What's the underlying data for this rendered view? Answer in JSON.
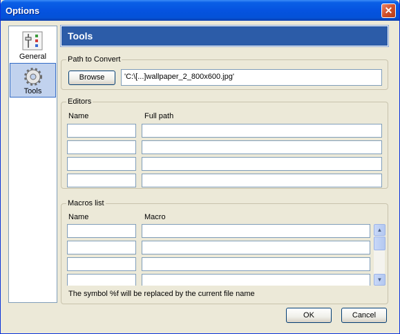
{
  "window": {
    "title": "Options",
    "close": "✕"
  },
  "sidebar": {
    "items": [
      {
        "label": "General",
        "icon": "sliders-icon",
        "selected": false
      },
      {
        "label": "Tools",
        "icon": "gear-icon",
        "selected": true
      }
    ]
  },
  "header": {
    "title": "Tools"
  },
  "path": {
    "legend": "Path to Convert",
    "browse_label": "Browse",
    "value": "'C:\\[...]wallpaper_2_800x600.jpg'"
  },
  "editors": {
    "legend": "Editors",
    "col_name": "Name",
    "col_path": "Full path",
    "rows": [
      {
        "name": "",
        "path": ""
      },
      {
        "name": "",
        "path": ""
      },
      {
        "name": "",
        "path": ""
      },
      {
        "name": "",
        "path": ""
      }
    ]
  },
  "macros": {
    "legend": "Macros list",
    "col_name": "Name",
    "col_macro": "Macro",
    "rows": [
      {
        "name": "",
        "macro": ""
      },
      {
        "name": "",
        "macro": ""
      },
      {
        "name": "",
        "macro": ""
      },
      {
        "name": "",
        "macro": ""
      }
    ],
    "note": "The symbol %f will be replaced by the current file name"
  },
  "footer": {
    "ok_label": "OK",
    "cancel_label": "Cancel"
  }
}
